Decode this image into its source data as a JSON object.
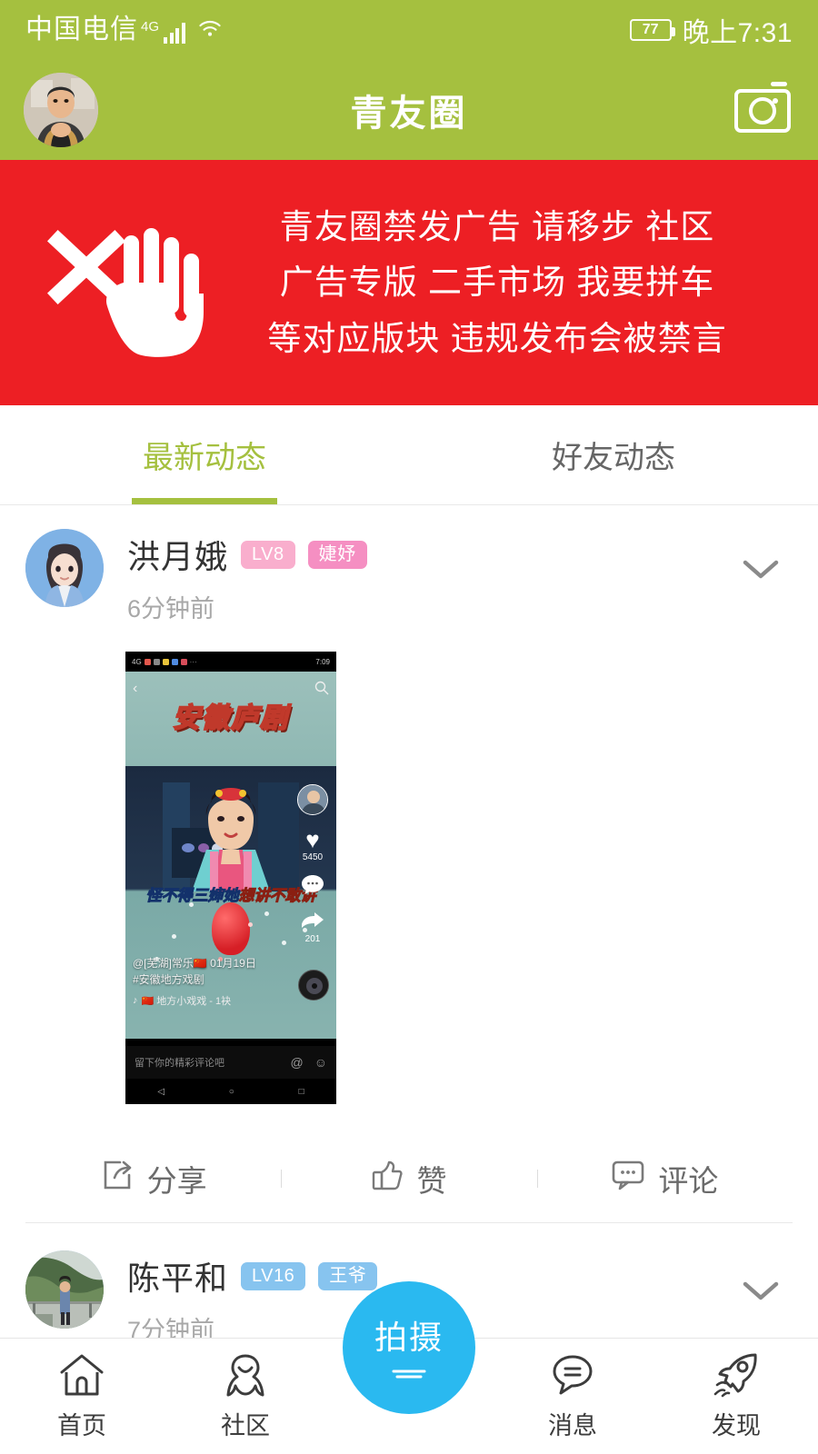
{
  "colors": {
    "brand_green": "#a5c03f",
    "banner_red": "#ed1f24",
    "accent_blue": "#2ab9f0",
    "badge_pink_light": "#f9aecd",
    "badge_pink": "#f58fc2",
    "badge_blue": "#87c4ef"
  },
  "statusbar": {
    "carrier": "中国电信",
    "network": "4G",
    "signal_icon": "signal-bars-icon",
    "wifi_icon": "wifi-icon",
    "battery_level": "77",
    "time": "晚上7:31"
  },
  "header": {
    "avatar_name": "user-avatar",
    "title": "青友圈",
    "camera_icon": "camera-icon"
  },
  "banner": {
    "close_icon": "x-icon",
    "hand_icon": "stop-hand-icon",
    "lines": [
      "青友圈禁发广告 请移步 社区",
      "广告专版 二手市场 我要拼车",
      "等对应版块 违规发布会被禁言"
    ]
  },
  "tabs": [
    {
      "label": "最新动态",
      "active": true
    },
    {
      "label": "好友动态",
      "active": false
    }
  ],
  "posts": [
    {
      "author": "洪月娥",
      "level_badge": "LV8",
      "title_badge": "婕妤",
      "badge_style": "pink",
      "time": "6分钟前",
      "more_icon": "chevron-down-icon",
      "attachment": {
        "type": "screenshot",
        "inner_status_time": "7:09",
        "back_icon": "back-arrow-icon",
        "search_icon": "search-icon",
        "video_title": "安徽庐剧",
        "subtitle_left": "怪不得三婶她",
        "subtitle_right": "想讲不敢讲",
        "like_icon": "heart-icon",
        "like_count": "5450",
        "comment_icon": "comment-bubble-icon",
        "share_icon": "share-arrow-icon",
        "share_count": "201",
        "caption_user": "@[芜湖]常乐🇨🇳",
        "caption_date": "01月19日",
        "caption_tag": "#安徽地方戏剧",
        "music_text": "🇨🇳  地方小戏戏 - 1袂",
        "comment_placeholder": "留下你的精彩评论吧",
        "at_icon": "at-icon",
        "emoji_icon": "emoji-icon"
      },
      "actions": [
        {
          "label": "分享",
          "icon": "share-icon"
        },
        {
          "label": "赞",
          "icon": "thumbs-up-icon"
        },
        {
          "label": "评论",
          "icon": "comment-icon"
        }
      ]
    },
    {
      "author": "陈平和",
      "level_badge": "LV16",
      "title_badge": "王爷",
      "badge_style": "blue",
      "time": "7分钟前",
      "more_icon": "chevron-down-icon"
    }
  ],
  "bottomnav": {
    "items": [
      {
        "label": "首页",
        "icon": "home-icon"
      },
      {
        "label": "社区",
        "icon": "community-icon"
      },
      {
        "label": "消息",
        "icon": "message-icon"
      },
      {
        "label": "发现",
        "icon": "discover-rocket-icon"
      }
    ],
    "shoot": {
      "label": "拍摄",
      "icon": "shoot-button"
    }
  }
}
